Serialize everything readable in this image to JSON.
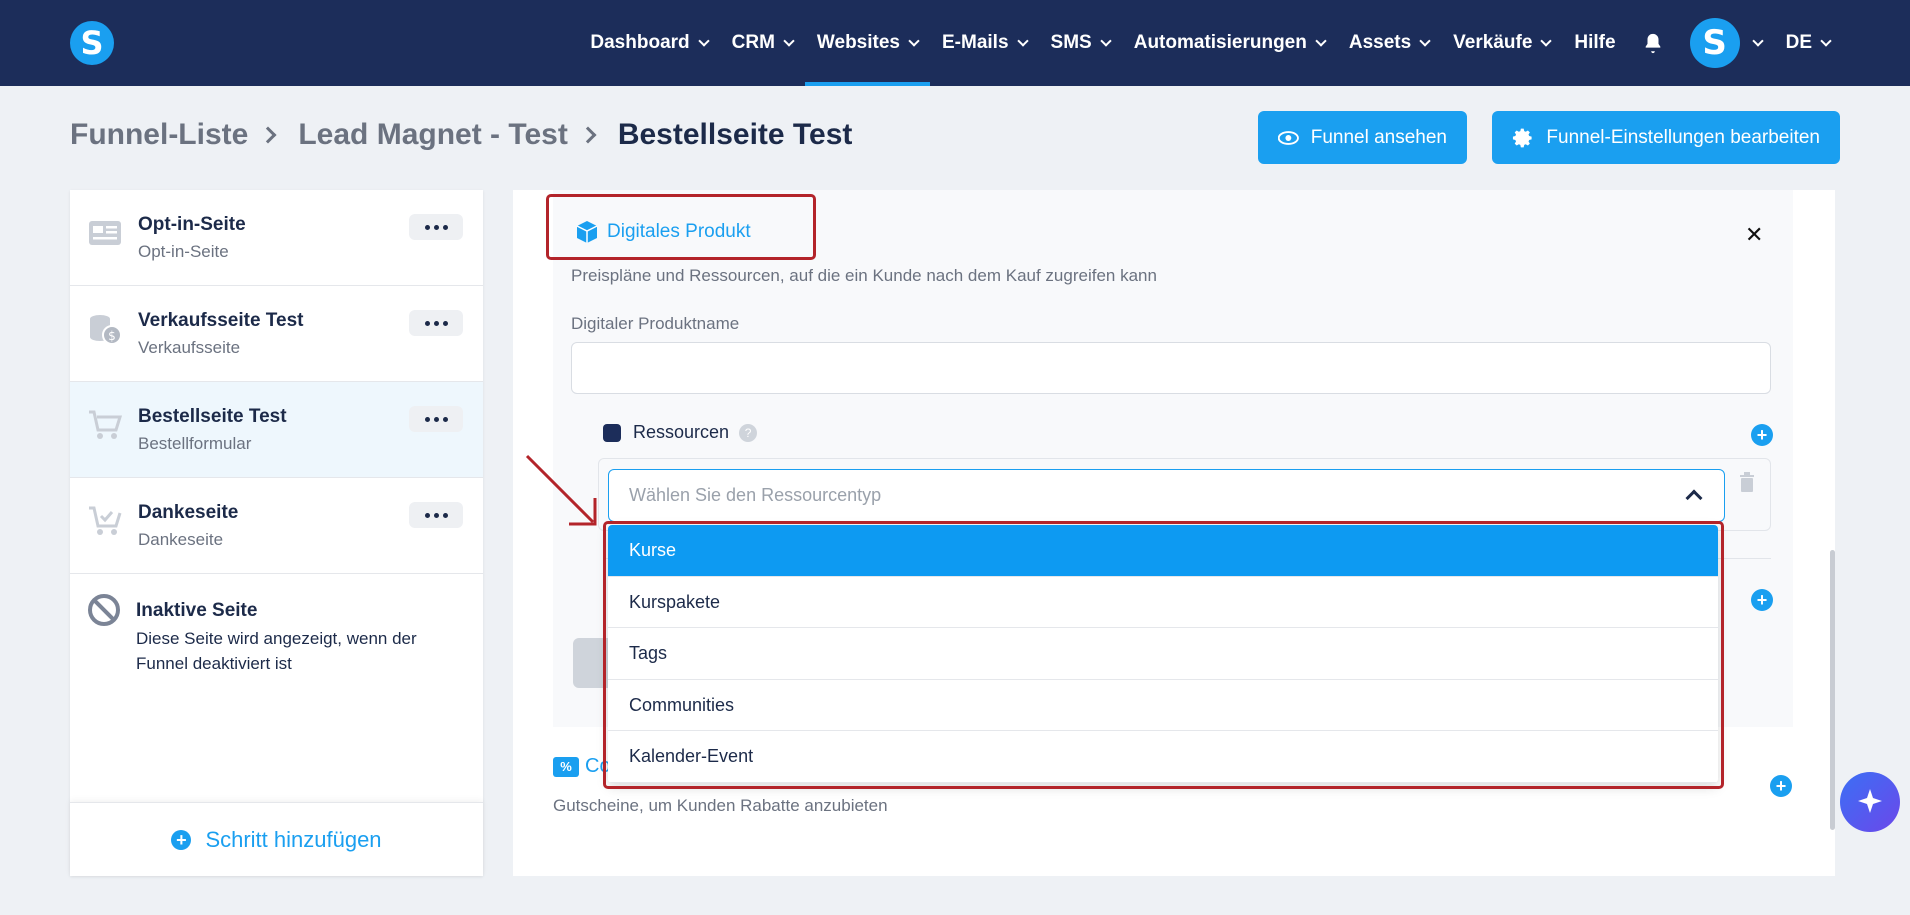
{
  "nav": {
    "logo": "S",
    "items": [
      {
        "label": "Dashboard",
        "chevron": true
      },
      {
        "label": "CRM",
        "chevron": true
      },
      {
        "label": "Websites",
        "chevron": true,
        "active": true
      },
      {
        "label": "E-Mails",
        "chevron": true
      },
      {
        "label": "SMS",
        "chevron": true
      },
      {
        "label": "Automatisierungen",
        "chevron": true
      },
      {
        "label": "Assets",
        "chevron": true
      },
      {
        "label": "Verkäufe",
        "chevron": true
      },
      {
        "label": "Hilfe",
        "chevron": false
      }
    ],
    "avatar": "S",
    "language": "DE"
  },
  "breadcrumb": {
    "items": [
      "Funnel-Liste",
      "Lead Magnet - Test"
    ],
    "current": "Bestellseite Test"
  },
  "actions": {
    "view_label": "Funnel ansehen",
    "settings_label": "Funnel-Einstellungen bearbeiten"
  },
  "steps": [
    {
      "title": "Opt-in-Seite",
      "subtitle": "Opt-in-Seite",
      "icon": "form-icon"
    },
    {
      "title": "Verkaufsseite Test",
      "subtitle": "Verkaufsseite",
      "icon": "coins-icon"
    },
    {
      "title": "Bestellseite Test",
      "subtitle": "Bestellformular",
      "icon": "cart-icon",
      "selected": true
    },
    {
      "title": "Dankeseite",
      "subtitle": "Dankeseite",
      "icon": "cart-check-icon"
    }
  ],
  "inactive": {
    "title": "Inaktive Seite",
    "description": "Diese Seite wird angezeigt, wenn der Funnel deaktiviert ist"
  },
  "add_step_label": "Schritt hinzufügen",
  "product": {
    "header": "Digitales Produkt",
    "description": "Preispläne und Ressourcen, auf die ein Kunde nach dem Kauf zugreifen kann",
    "name_label": "Digitaler Produktname",
    "name_value": "",
    "resources_label": "Ressourcen",
    "resource_placeholder": "Wählen Sie den Ressourcentyp"
  },
  "dropdown": {
    "options": [
      "Kurse",
      "Kurspakete",
      "Tags",
      "Communities",
      "Kalender-Event"
    ],
    "highlighted": "Kurse"
  },
  "coupon": {
    "label": "Co",
    "description": "Gutscheine, um Kunden Rabatte anzubieten"
  },
  "colors": {
    "nav_bg": "#1c2d5a",
    "accent": "#1a9ff0",
    "annotation": "#b3242a"
  }
}
